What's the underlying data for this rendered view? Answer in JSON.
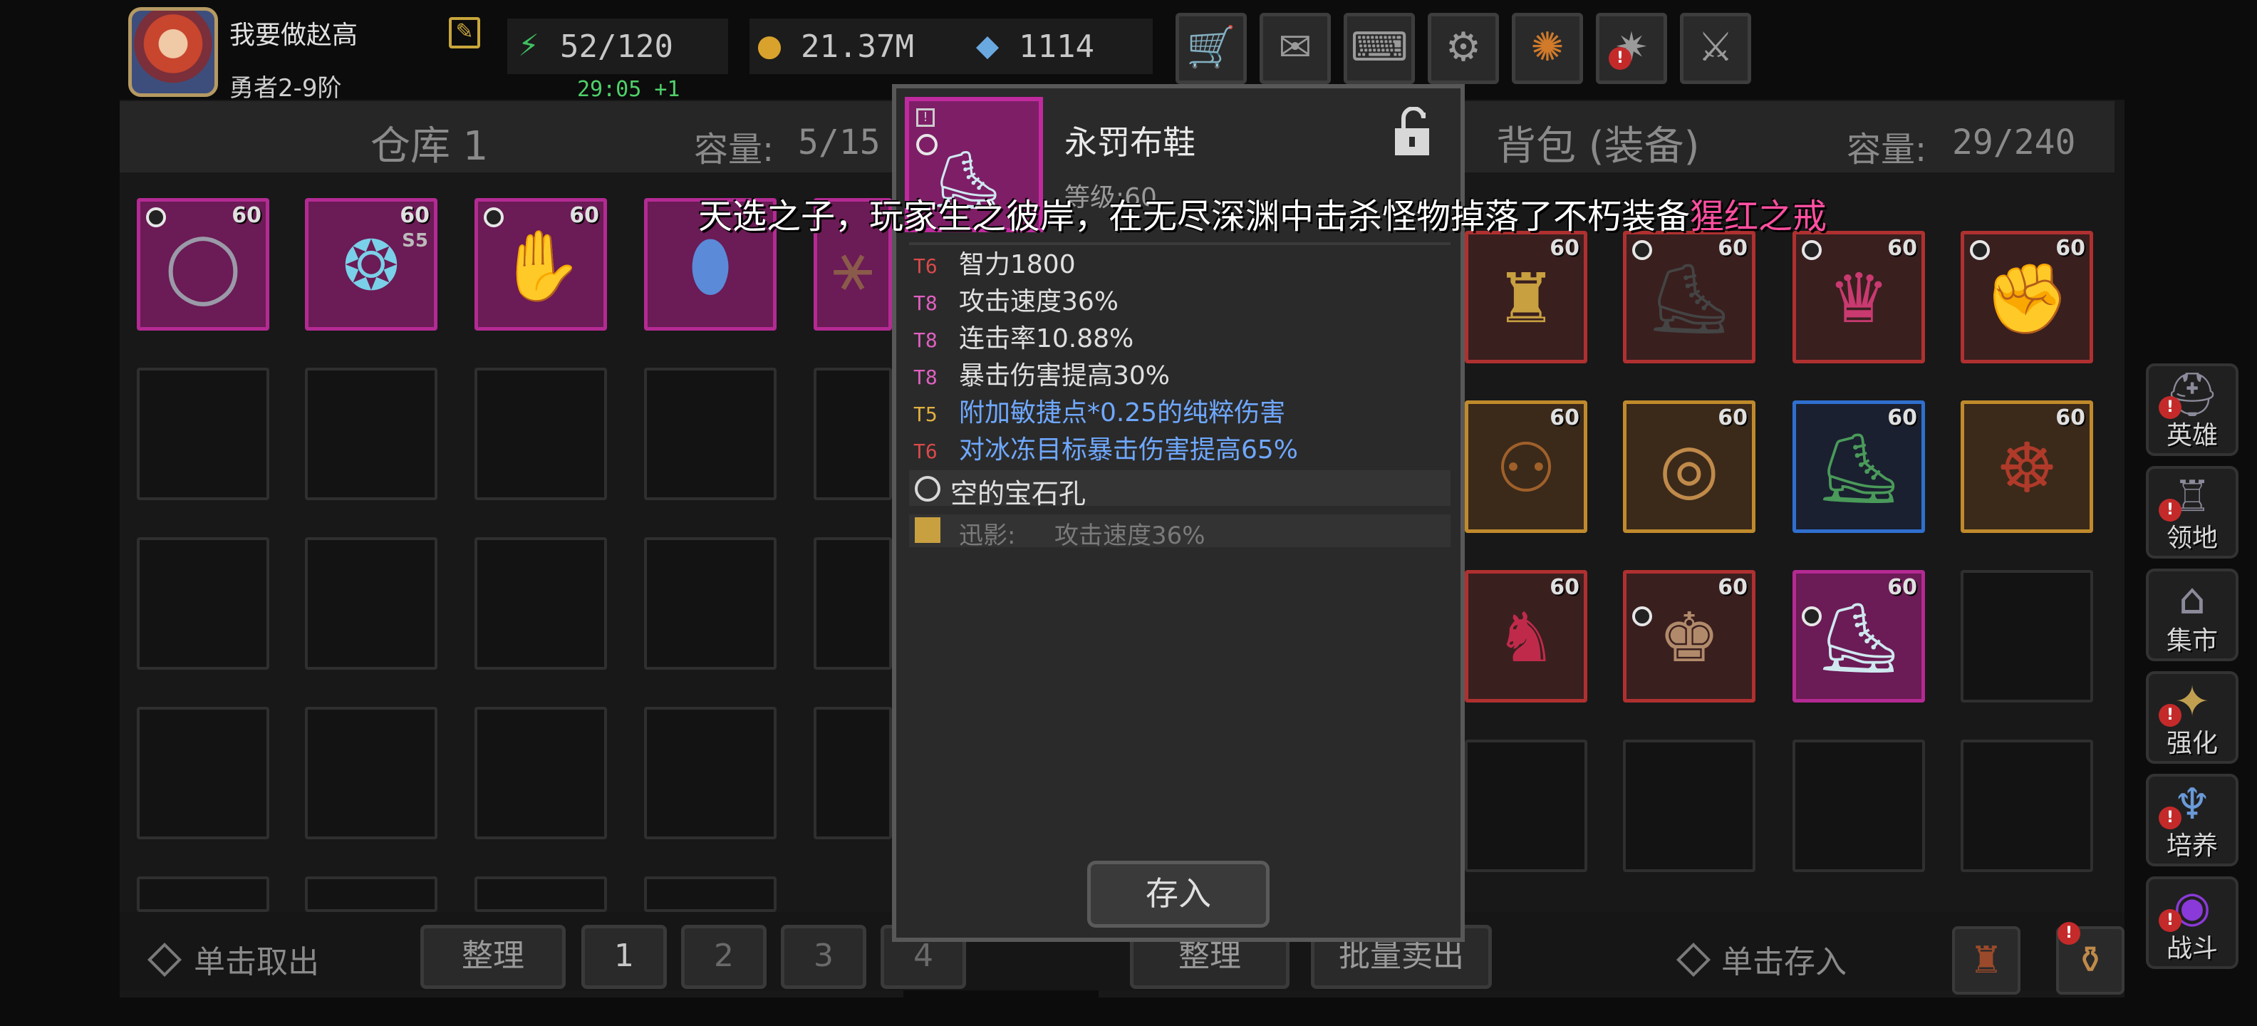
{
  "player": {
    "name": "我要做赵高",
    "rank": "勇者2-9阶"
  },
  "resources": {
    "stamina": "52/120",
    "stamina_timer": "29:05 +1",
    "gold": "21.37M",
    "gems": "1114"
  },
  "top_buttons": [
    "shop-cart-icon",
    "mail-icon",
    "gamepad-icon",
    "gear-icon",
    "lucky-wheel-icon",
    "event-icon",
    "battle-swords-icon"
  ],
  "warehouse": {
    "title": "仓库 1",
    "capacity_label": "容量:",
    "capacity_value": "5/15",
    "items": [
      {
        "level": "60",
        "glyph": "◯",
        "tier": "",
        "rarity": "pink"
      },
      {
        "level": "60",
        "glyph": "❂",
        "tier": "S5",
        "rarity": "pink"
      },
      {
        "level": "60",
        "glyph": "✋",
        "tier": "",
        "rarity": "pink"
      },
      {
        "level": "",
        "glyph": "⬮",
        "tier": "",
        "rarity": "pink"
      },
      {
        "level": "",
        "glyph": "⚹",
        "tier": "",
        "rarity": "pink"
      }
    ],
    "bottom": {
      "take_out": "单击取出",
      "sort": "整理",
      "pages": [
        "1",
        "2",
        "3",
        "4"
      ]
    }
  },
  "backpack": {
    "title": "背包 (装备)",
    "capacity_label": "容量:",
    "capacity_value": "29/240",
    "items": [
      {
        "level": "60",
        "rarity": "red",
        "glyph": "♜"
      },
      {
        "level": "60",
        "rarity": "red",
        "glyph": "⛸"
      },
      {
        "level": "60",
        "rarity": "red",
        "glyph": "♛"
      },
      {
        "level": "60",
        "rarity": "red",
        "glyph": "✊"
      },
      {
        "level": "60",
        "rarity": "orange",
        "glyph": "⚇"
      },
      {
        "level": "60",
        "rarity": "orange",
        "glyph": "◎"
      },
      {
        "level": "60",
        "rarity": "blue",
        "glyph": "⛸"
      },
      {
        "level": "60",
        "rarity": "orange",
        "glyph": "☸"
      },
      {
        "level": "60",
        "rarity": "red",
        "glyph": "♞"
      },
      {
        "level": "60",
        "rarity": "red",
        "glyph": "♚"
      },
      {
        "level": "60",
        "rarity": "pink",
        "glyph": "⛸"
      }
    ],
    "bottom": {
      "sort": "整理",
      "bulk_sell": "批量卖出",
      "deposit_hint": "单击存入"
    }
  },
  "side_nav": [
    {
      "label": "英雄",
      "icon": "helmet-icon"
    },
    {
      "label": "领地",
      "icon": "castle-icon"
    },
    {
      "label": "集市",
      "icon": "market-icon"
    },
    {
      "label": "强化",
      "icon": "upgrade-icon"
    },
    {
      "label": "培养",
      "icon": "chalice-icon"
    },
    {
      "label": "战斗",
      "icon": "portal-icon"
    }
  ],
  "tooltip": {
    "item_name": "永罚布鞋",
    "level_label": "等级:60",
    "stats": [
      {
        "tier": "T6",
        "text": "智力1800",
        "tier_color": "#d94a4a",
        "text_color": "#e0e0e0"
      },
      {
        "tier": "T8",
        "text": "攻击速度36%",
        "tier_color": "#e060c0",
        "text_color": "#e0e0e0"
      },
      {
        "tier": "T8",
        "text": "连击率10.88%",
        "tier_color": "#e060c0",
        "text_color": "#e0e0e0"
      },
      {
        "tier": "T8",
        "text": "暴击伤害提高30%",
        "tier_color": "#e060c0",
        "text_color": "#e0e0e0"
      },
      {
        "tier": "T5",
        "text": "附加敏捷点*0.25的纯粹伤害",
        "tier_color": "#e0b040",
        "text_color": "#6fa8ff"
      },
      {
        "tier": "T6",
        "text": "对冰冻目标暴击伤害提高65%",
        "tier_color": "#d94a4a",
        "text_color": "#6fa8ff"
      }
    ],
    "gem_slot": "空的宝石孔",
    "shadow_label": "迅影:",
    "shadow_value": "攻击速度36%",
    "deposit_button": "存入"
  },
  "broadcast": {
    "text": "天选之子，玩家生之彼岸，在无尽深渊中击杀怪物掉落了不朽装备",
    "highlight": "猩红之戒"
  },
  "colors": {
    "pink_rarity": "#b42a93",
    "red_rarity": "#b03030",
    "orange_rarity": "#c08a2c",
    "blue_rarity": "#2f6fcf",
    "timer_green": "#4fd06a",
    "highlight_pink": "#ff4fa0"
  }
}
